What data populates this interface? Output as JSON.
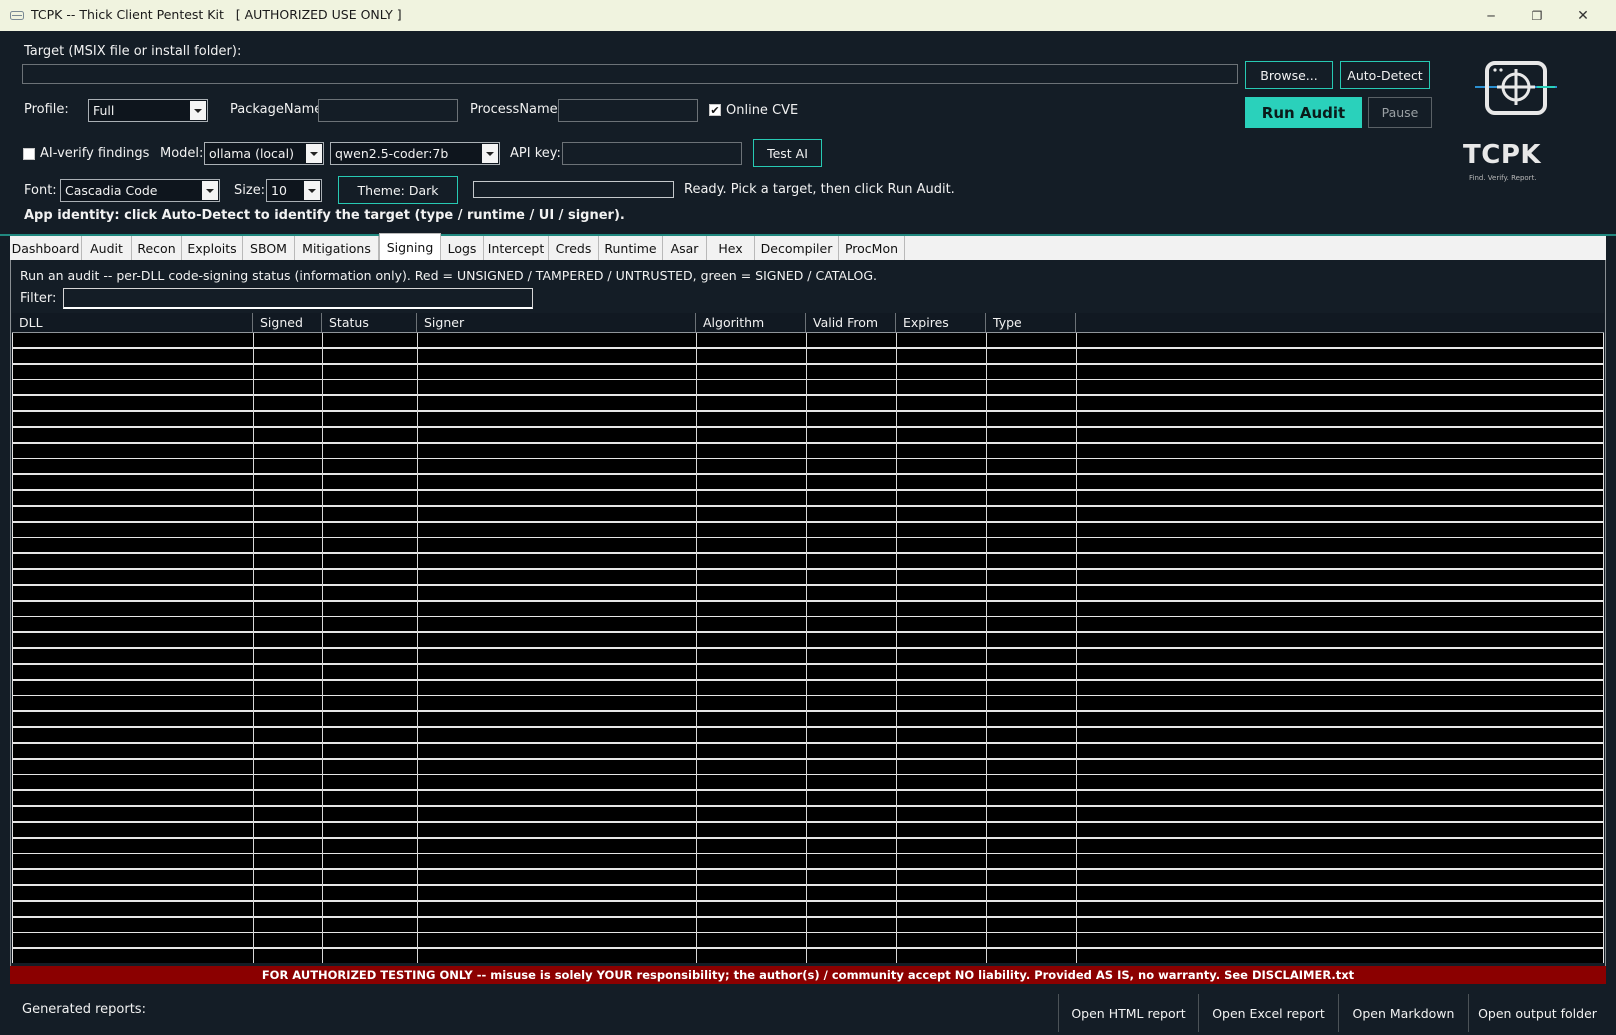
{
  "window": {
    "title": "TCPK -- Thick Client Pentest Kit   [ AUTHORIZED USE ONLY ]",
    "minimize": "─",
    "restore": "❐",
    "close": "✕"
  },
  "target": {
    "label": "Target (MSIX file or install folder):",
    "value": "",
    "browse": "Browse...",
    "auto_detect": "Auto-Detect"
  },
  "profile": {
    "label": "Profile:",
    "value": "Full",
    "package_label": "PackageName:",
    "package_value": "",
    "process_label": "ProcessName:",
    "process_value": "",
    "online_cve_label": "Online CVE",
    "online_cve_checked": true
  },
  "actions": {
    "run_audit": "Run Audit",
    "pause": "Pause"
  },
  "ai": {
    "verify_label": "AI-verify findings",
    "verify_checked": false,
    "model_label": "Model:",
    "model_value": "ollama (local)",
    "model_name": "qwen2.5-coder:7b",
    "api_key_label": "API key:",
    "api_key_value": "",
    "test_ai": "Test AI"
  },
  "appearance": {
    "font_label": "Font:",
    "font_value": "Cascadia Code",
    "size_label": "Size:",
    "size_value": "10",
    "theme_button": "Theme: Dark"
  },
  "status": {
    "text": "Ready. Pick a target, then click Run Audit.",
    "progress": 0
  },
  "identity_hint": "App identity: click Auto-Detect to identify the target (type / runtime / UI / signer).",
  "logo": {
    "icon": "crosshair-window-icon",
    "title": "TCPK",
    "tagline": "Find. Verify. Report."
  },
  "tabs": [
    {
      "label": "Dashboard"
    },
    {
      "label": "Audit"
    },
    {
      "label": "Recon"
    },
    {
      "label": "Exploits"
    },
    {
      "label": "SBOM"
    },
    {
      "label": "Mitigations"
    },
    {
      "label": "Signing"
    },
    {
      "label": "Logs"
    },
    {
      "label": "Intercept"
    },
    {
      "label": "Creds"
    },
    {
      "label": "Runtime"
    },
    {
      "label": "Asar"
    },
    {
      "label": "Hex"
    },
    {
      "label": "Decompiler"
    },
    {
      "label": "ProcMon"
    }
  ],
  "active_tab": "Signing",
  "signing": {
    "info": "Run an audit -- per-DLL code-signing status (information only). Red = UNSIGNED / TAMPERED / UNTRUSTED, green = SIGNED / CATALOG.",
    "filter_label": "Filter:",
    "filter_value": "",
    "columns": [
      "DLL",
      "Signed",
      "Status",
      "Signer",
      "Algorithm",
      "Valid From",
      "Expires",
      "Type"
    ],
    "rows": []
  },
  "disclaimer": "FOR AUTHORIZED TESTING ONLY  --  misuse is solely YOUR responsibility; the author(s) / community accept NO liability.  Provided AS IS, no warranty.  See DISCLAIMER.txt",
  "reports": {
    "label": "Generated reports:",
    "buttons": [
      "Open HTML report",
      "Open Excel report",
      "Open Markdown",
      "Open output folder"
    ]
  },
  "colors": {
    "accent": "#2ad1bb",
    "background": "#141d26",
    "disclaimer_bg": "#8b0000"
  }
}
